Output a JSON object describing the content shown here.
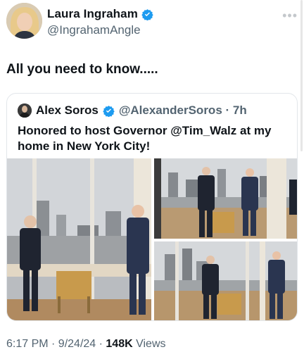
{
  "author": {
    "display_name": "Laura Ingraham",
    "handle": "@IngrahamAngle",
    "verified_icon": "verified-badge-icon"
  },
  "tweet": {
    "text": "All you need to know....."
  },
  "quoted": {
    "display_name": "Alex Soros",
    "handle_time": "@AlexanderSoros · 7h",
    "text": "Honored to host Governor @Tim_Walz at my home in New York City!"
  },
  "meta": {
    "time_date": "6:17 PM · 9/24/24 · ",
    "views_count": "148K",
    "views_label": " Views"
  },
  "colors": {
    "verified_blue": "#1d9bf0",
    "secondary_text": "#536471",
    "primary_text": "#0f1419"
  }
}
